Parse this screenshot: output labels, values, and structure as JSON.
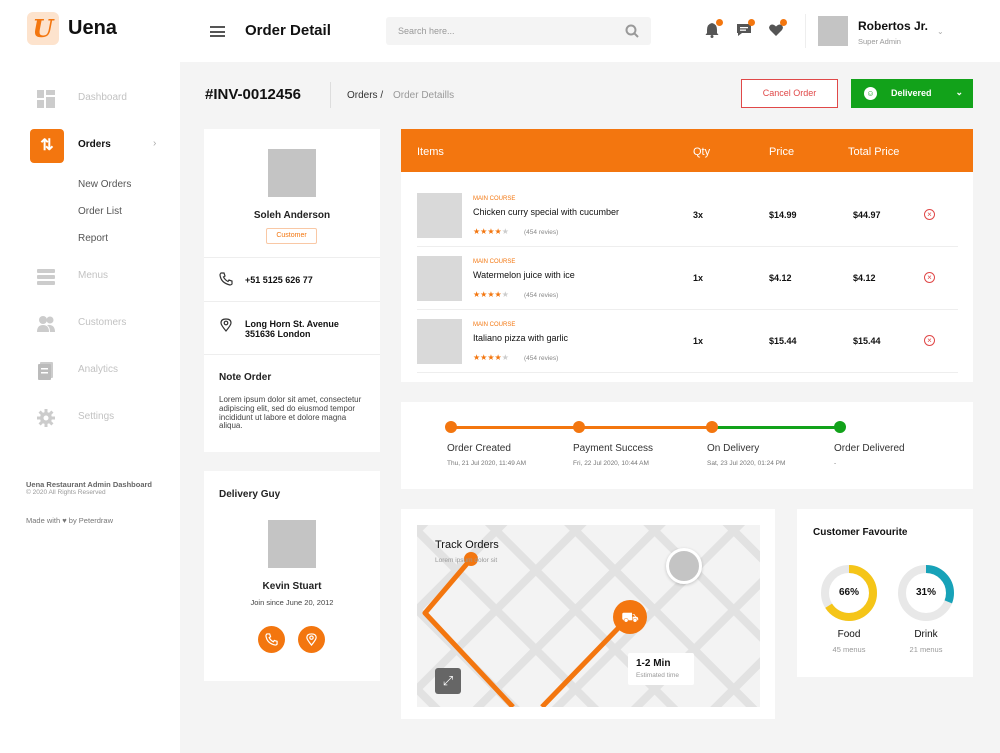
{
  "app": {
    "logo_letter": "U",
    "name": "Uena"
  },
  "sidebar": {
    "items": [
      {
        "label": "Dashboard",
        "icon": "grid-icon"
      },
      {
        "label": "Orders",
        "icon": "swap-vertical-icon"
      },
      {
        "label": "Menus",
        "icon": "list-icon"
      },
      {
        "label": "Customers",
        "icon": "users-icon"
      },
      {
        "label": "Analytics",
        "icon": "document-icon"
      },
      {
        "label": "Settings",
        "icon": "gear-icon"
      }
    ],
    "sub_items": [
      "New Orders",
      "Order List",
      "Report"
    ],
    "footer_title": "Uena Restaurant Admin Dashboard",
    "footer_copy": "© 2020 All Rights Reserved",
    "footer_made": "Made with ♥ by Peterdraw"
  },
  "header": {
    "title": "Order Detail",
    "search_placeholder": "Search here...",
    "user_name": "Robertos Jr.",
    "user_role": "Super Admin"
  },
  "order": {
    "invoice": "#INV-0012456",
    "breadcrumb_1": "Orders /",
    "breadcrumb_2": "Order Detaills",
    "cancel_label": "Cancel Order",
    "status_label": "Delivered"
  },
  "customer": {
    "name": "Soleh Anderson",
    "badge": "Customer",
    "phone": "+51 5125 626 77",
    "address_line1": "Long Horn St. Avenue",
    "address_line2": "351636 London",
    "note_title": "Note Order",
    "note_body": "Lorem ipsum dolor sit amet, consectetur adipiscing elit, sed do eiusmod tempor incididunt ut labore et dolore magna aliqua."
  },
  "delivery": {
    "title": "Delivery Guy",
    "name": "Kevin Stuart",
    "since": "Join since June 20, 2012"
  },
  "items_table": {
    "headers": [
      "Items",
      "Qty",
      "Price",
      "Total Price"
    ],
    "rows": [
      {
        "category": "MAIN COURSE",
        "name": "Chicken curry special with cucumber",
        "rating": 4,
        "reviews": "(454 revies)",
        "qty": "3x",
        "price": "$14.99",
        "total": "$44.97"
      },
      {
        "category": "MAIN COURSE",
        "name": "Watermelon juice with ice",
        "rating": 4,
        "reviews": "(454 revies)",
        "qty": "1x",
        "price": "$4.12",
        "total": "$4.12"
      },
      {
        "category": "MAIN COURSE",
        "name": "Italiano pizza with garlic",
        "rating": 4,
        "reviews": "(454 revies)",
        "qty": "1x",
        "price": "$15.44",
        "total": "$15.44"
      }
    ]
  },
  "timeline": {
    "steps": [
      {
        "label": "Order Created",
        "date": "Thu, 21 Jul 2020, 11:49 AM"
      },
      {
        "label": "Payment Success",
        "date": "Fri, 22 Jul 2020, 10:44 AM"
      },
      {
        "label": "On Delivery",
        "date": "Sat, 23 Jul 2020, 01:24 PM"
      },
      {
        "label": "Order Delivered",
        "date": "-"
      }
    ],
    "colors": {
      "orange": "#f3760f",
      "green": "#12a21a"
    }
  },
  "track": {
    "title": "Track Orders",
    "subtitle": "Lorem ipsum dolor sit",
    "eta": "1-2 Min",
    "eta_label": "Estimated time"
  },
  "favourite": {
    "title": "Customer Favourite",
    "items": [
      {
        "name": "Food",
        "percent_label": "66%",
        "percent": 66,
        "sub": "45 menus",
        "color": "#f5c518"
      },
      {
        "name": "Drink",
        "percent_label": "31%",
        "percent": 31,
        "sub": "21 menus",
        "color": "#17a2b8"
      }
    ]
  }
}
